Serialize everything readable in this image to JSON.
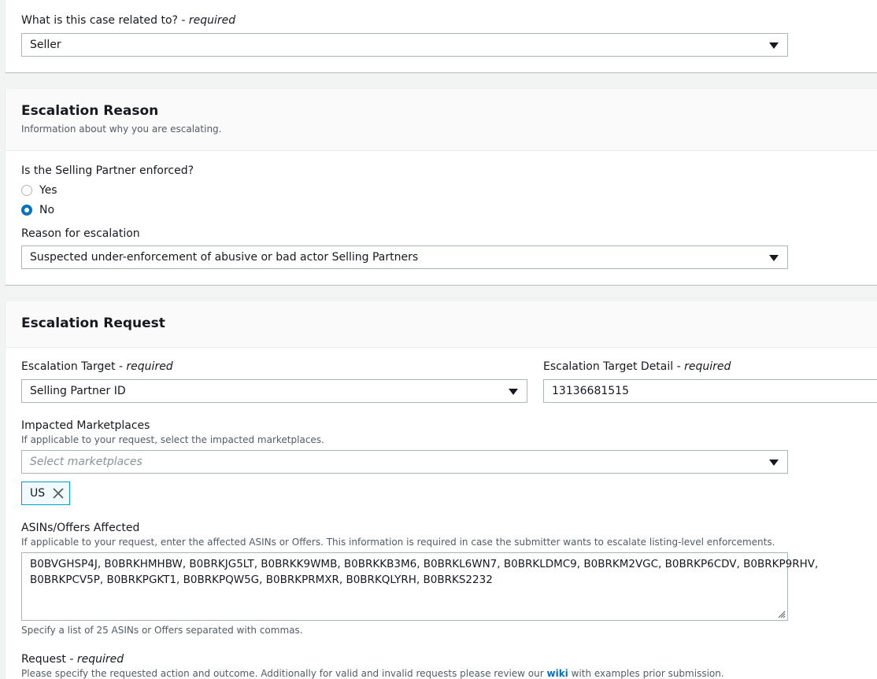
{
  "case_section": {
    "related_label": "What is this case related to?",
    "required_text": "- required",
    "related_value": "Seller"
  },
  "escalation_reason": {
    "title": "Escalation Reason",
    "description": "Information about why you are escalating.",
    "enforced_question": "Is the Selling Partner enforced?",
    "options": [
      {
        "label": "Yes",
        "checked": false
      },
      {
        "label": "No",
        "checked": true
      }
    ],
    "reason_label": "Reason for escalation",
    "reason_value": "Suspected under-enforcement of abusive or bad actor Selling Partners"
  },
  "escalation_request": {
    "title": "Escalation Request",
    "target_label": "Escalation Target",
    "target_required": "- required",
    "target_value": "Selling Partner ID",
    "detail_label": "Escalation Target Detail",
    "detail_required": "- required",
    "detail_value": "13136681515",
    "marketplaces_label": "Impacted Marketplaces",
    "marketplaces_hint": "If applicable to your request, select the impacted marketplaces.",
    "marketplaces_placeholder": "Select marketplaces",
    "marketplace_tokens": [
      "US"
    ],
    "asins_label": "ASINs/Offers Affected",
    "asins_hint": "If applicable to your request, enter the affected ASINs or Offers. This information is required in case the submitter wants to escalate listing-level enforcements.",
    "asins_line1": "B0BVGHSP4J, B0BRKHMHBW, B0BRKJG5LT, B0BRKK9WMB, B0BRKKB3M6, B0BRKL6WN7, B0BRKLDMC9, B0BRKM2VGC, B0BRKP6CDV, B0BRKP9RHV,",
    "asins_line2": "B0BRKPCV5P, B0BRKPGKT1, B0BRKPQW5G, B0BRKPRMXR, B0BRKQLYRH, B0BRKS2232",
    "asins_footer": "Specify a list of 25 ASINs or Offers separated with commas.",
    "request_label": "Request",
    "request_required": "- required",
    "request_hint_before": "Please specify the requested action and outcome. Additionally for valid and invalid requests please review our ",
    "request_hint_link": "wiki",
    "request_hint_after": " with examples prior submission."
  }
}
